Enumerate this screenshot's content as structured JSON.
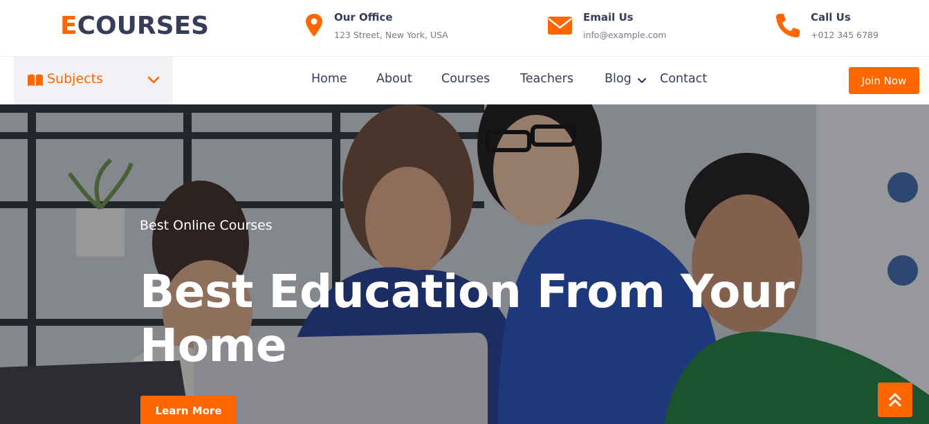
{
  "brand": {
    "logo_first": "E",
    "logo_rest": "COURSES",
    "accent_color": "#ff6600",
    "dark_color": "#363d58"
  },
  "topbar": {
    "contacts": [
      {
        "icon": "map-pin-icon",
        "title": "Our Office",
        "value": "123 Street, New York, USA"
      },
      {
        "icon": "envelope-icon",
        "title": "Email Us",
        "value": "info@example.com"
      },
      {
        "icon": "phone-icon",
        "title": "Call Us",
        "value": "+012 345 6789"
      }
    ]
  },
  "nav": {
    "subjects": {
      "icon": "book-open-icon",
      "label": "Subjects",
      "caret": "chevron-down-icon"
    },
    "items": [
      {
        "label": "Home"
      },
      {
        "label": "About"
      },
      {
        "label": "Courses"
      },
      {
        "label": "Teachers"
      },
      {
        "label": "Blog",
        "has_dropdown": true
      },
      {
        "label": "Contact"
      }
    ],
    "cta": "Join Now"
  },
  "hero": {
    "kicker": "Best Online Courses",
    "title": "Best Education From Your Home",
    "button": "Learn More",
    "image": "group-of-students-at-laptop-photo"
  },
  "back_to_top": {
    "icon": "double-chevron-up-icon"
  }
}
